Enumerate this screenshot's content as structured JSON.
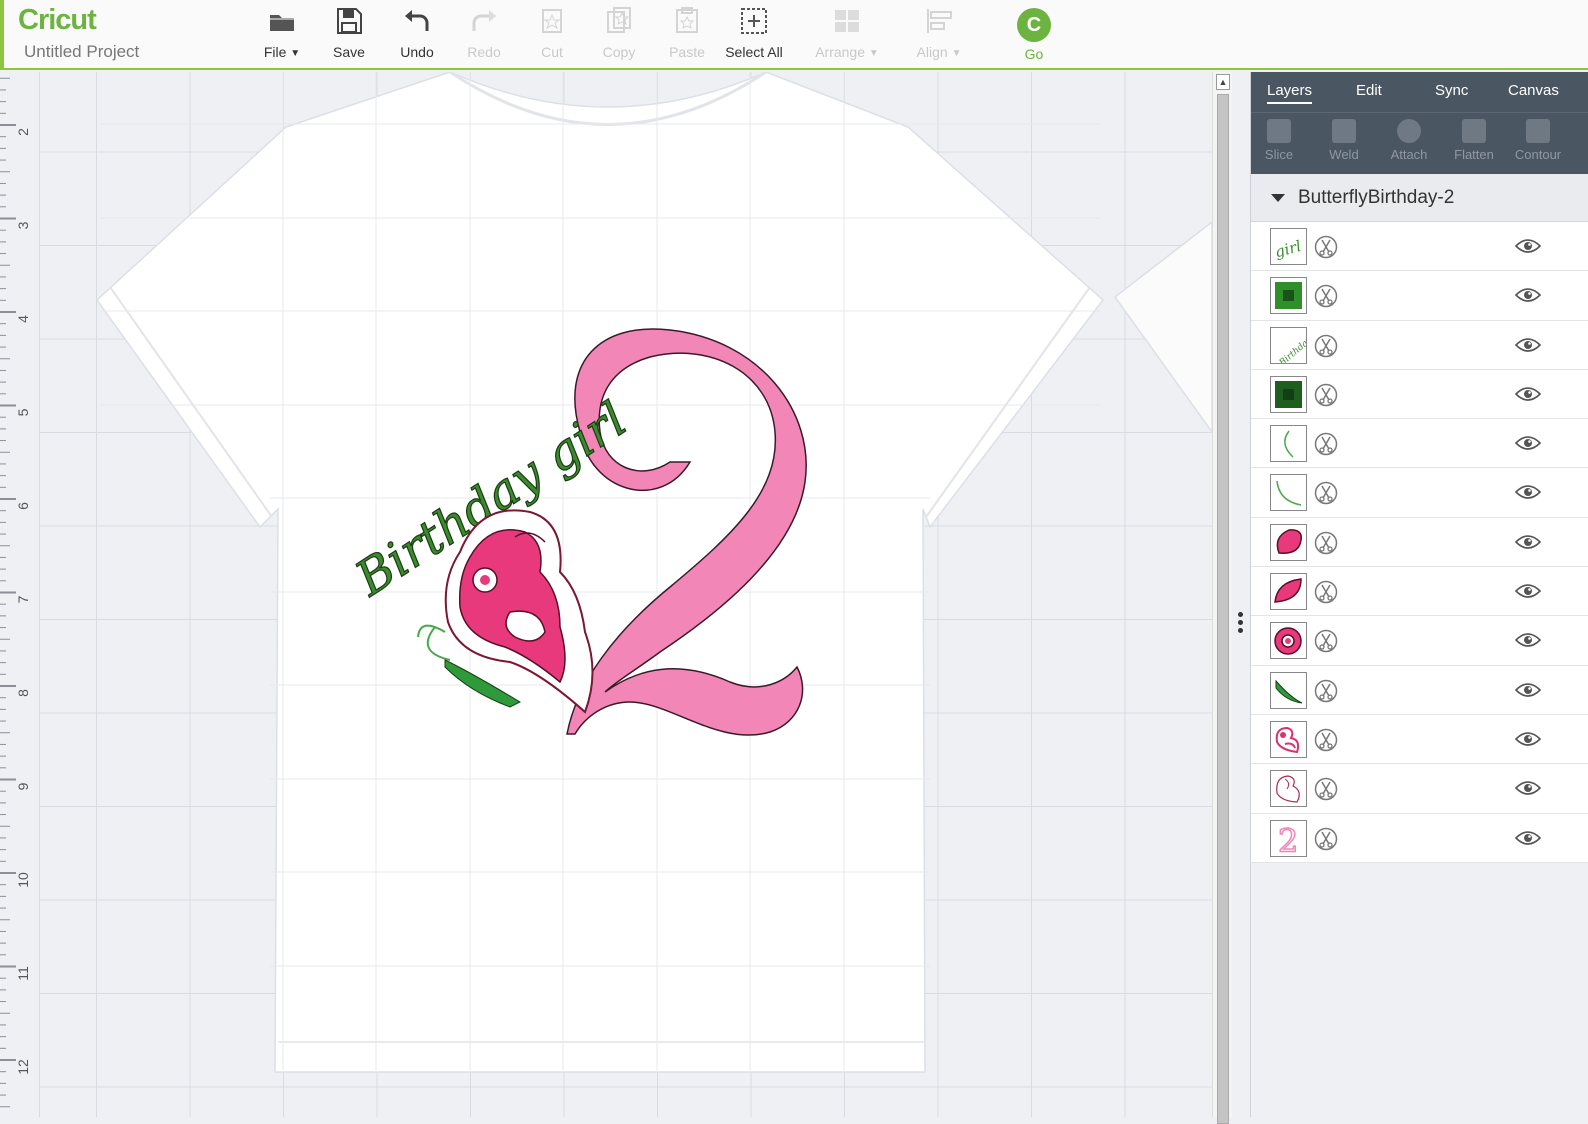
{
  "app": {
    "logo": "Cricut",
    "project_title": "Untitled Project"
  },
  "toolbar": {
    "file": "File",
    "save": "Save",
    "undo": "Undo",
    "redo": "Redo",
    "cut": "Cut",
    "copy": "Copy",
    "paste": "Paste",
    "select_all": "Select All",
    "arrange": "Arrange",
    "align": "Align",
    "go": "Go",
    "go_glyph": "C"
  },
  "ruler": {
    "marks": [
      "2",
      "3",
      "4",
      "5",
      "6",
      "7",
      "8",
      "9",
      "10",
      "11",
      "12"
    ]
  },
  "design": {
    "text": "Birthday girl",
    "number": "2",
    "shirt_color": "#ffffff",
    "number_color": "#f287b7",
    "text_color": "#3a8a2e",
    "wing_color": "#e8397d"
  },
  "panel": {
    "tabs": [
      "Layers",
      "Edit",
      "Sync",
      "Canvas"
    ],
    "tools": [
      "Slice",
      "Weld",
      "Attach",
      "Flatten",
      "Contour"
    ],
    "group_name": "ButterflyBirthday-2",
    "layers": [
      {
        "thumb": "girl-text",
        "color": "#3a8a2e",
        "label": "girl"
      },
      {
        "thumb": "green-square",
        "color": "#2f8f2a",
        "label": ""
      },
      {
        "thumb": "birthday-text",
        "color": "#3a8a2e",
        "label": "Birthday"
      },
      {
        "thumb": "green-square",
        "color": "#1e5e1e",
        "label": ""
      },
      {
        "thumb": "antenna-left",
        "color": "#4aa84a",
        "label": ""
      },
      {
        "thumb": "antenna-right",
        "color": "#4aa84a",
        "label": ""
      },
      {
        "thumb": "pink-oval",
        "color": "#e8397d",
        "label": ""
      },
      {
        "thumb": "pink-leaf",
        "color": "#e8397d",
        "label": ""
      },
      {
        "thumb": "pink-ring",
        "color": "#e8397d",
        "label": ""
      },
      {
        "thumb": "green-body",
        "color": "#2f9a3a",
        "label": ""
      },
      {
        "thumb": "wing-outline",
        "color": "#d8336e",
        "label": ""
      },
      {
        "thumb": "wing-outline-2",
        "color": "#b0284f",
        "label": ""
      },
      {
        "thumb": "number-2",
        "color": "#f287b7",
        "label": "2"
      }
    ]
  }
}
